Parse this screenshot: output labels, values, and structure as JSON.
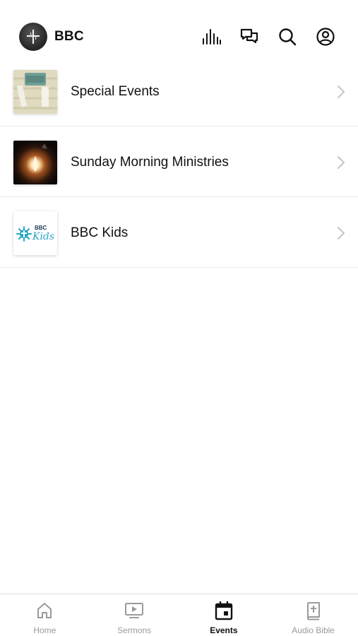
{
  "header": {
    "title": "BBC",
    "icons": [
      "cross-logo-icon",
      "audio-bars-icon",
      "chat-icon",
      "search-icon",
      "profile-icon"
    ]
  },
  "events": [
    {
      "label": "Special Events",
      "thumb": "typewriter-image"
    },
    {
      "label": "Sunday Morning Ministries",
      "thumb": "candle-image"
    },
    {
      "label": "BBC Kids",
      "thumb": "bbc-kids-logo"
    }
  ],
  "bbc_kids_logo": {
    "text_top": "BBC",
    "text_script": "Kids"
  },
  "tabs": [
    {
      "label": "Home",
      "icon": "home-icon"
    },
    {
      "label": "Sermons",
      "icon": "video-play-icon"
    },
    {
      "label": "Events",
      "icon": "calendar-icon",
      "active": true
    },
    {
      "label": "Audio Bible",
      "icon": "bible-icon"
    }
  ],
  "colors": {
    "active_tab": "#111111",
    "inactive_tab": "#9a9a9a",
    "kids_accent": "#2aa6c8"
  }
}
